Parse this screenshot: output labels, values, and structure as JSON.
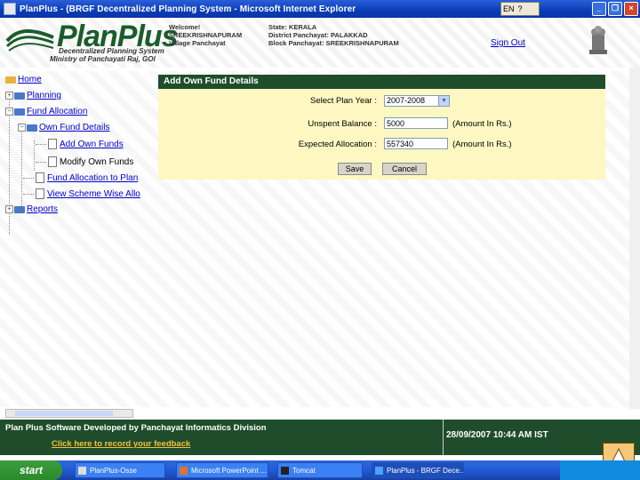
{
  "window": {
    "title": "PlanPlus - (BRGF Decentralized Planning System - Microsoft Internet Explorer",
    "lang": "EN"
  },
  "header": {
    "logo": "PlanPlus",
    "sub1": "Decentralized Planning System",
    "sub2": "Ministry of Panchayati Raj, GOI",
    "welcome_label": "Welcome!",
    "welcome_name": "SREEKRISHNAPURAM",
    "welcome_type": "Village Panchayat",
    "state": "State: KERALA",
    "district": "District Panchayat: PALAKKAD",
    "block": "Block Panchayat: SREEKRISHNAPURAM",
    "signout": "Sign Out"
  },
  "tree": {
    "home": "Home",
    "planning": "Planning",
    "fund_allocation": "Fund Allocation",
    "own_fund_details": "Own Fund Details",
    "add_own_funds": "Add Own Funds",
    "modify_own_funds": "Modify Own Funds",
    "fund_allocation_to_plan": "Fund Allocation to Plan",
    "view_scheme_wise": "View Scheme Wise Allo",
    "reports": "Reports"
  },
  "form": {
    "heading": "Add Own Fund Details",
    "plan_year_label": "Select Plan Year :",
    "plan_year_value": "2007-2008",
    "unspent_label": "Unspent Balance :",
    "unspent_value": "5000",
    "expected_label": "Expected Allocation :",
    "expected_value": "557340",
    "amount_hint": "(Amount In Rs.)",
    "save": "Save",
    "cancel": "Cancel"
  },
  "footer": {
    "credit": "Plan Plus Software Developed by Panchayat Informatics Division",
    "feedback": "Click here to record your feedback",
    "datetime": "28/09/2007 10:44 AM IST"
  },
  "taskbar": {
    "start": "start",
    "items": [
      "PlanPlus-Osse",
      "Microsoft PowerPoint ...",
      "Tomcat",
      "PlanPlus - BRGF Dece..."
    ]
  }
}
